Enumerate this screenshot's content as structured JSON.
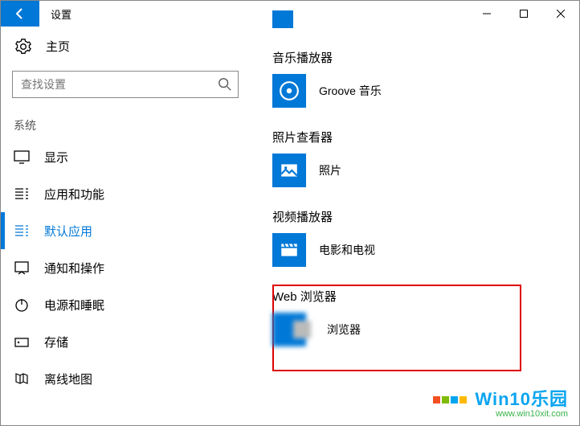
{
  "titlebar": {
    "title": "设置"
  },
  "sidebar": {
    "home": "主页",
    "search_placeholder": "查找设置",
    "category": "系统",
    "items": [
      {
        "label": "显示"
      },
      {
        "label": "应用和功能"
      },
      {
        "label": "默认应用"
      },
      {
        "label": "通知和操作"
      },
      {
        "label": "电源和睡眠"
      },
      {
        "label": "存储"
      },
      {
        "label": "离线地图"
      }
    ]
  },
  "content": {
    "sections": [
      {
        "title": "音乐播放器",
        "app": "Groove 音乐"
      },
      {
        "title": "照片查看器",
        "app": "照片"
      },
      {
        "title": "视频播放器",
        "app": "电影和电视"
      },
      {
        "title": "Web 浏览器",
        "app": "浏览器"
      }
    ]
  },
  "watermark": {
    "text": "Win10乐园",
    "url": "www.win10xit.com"
  }
}
